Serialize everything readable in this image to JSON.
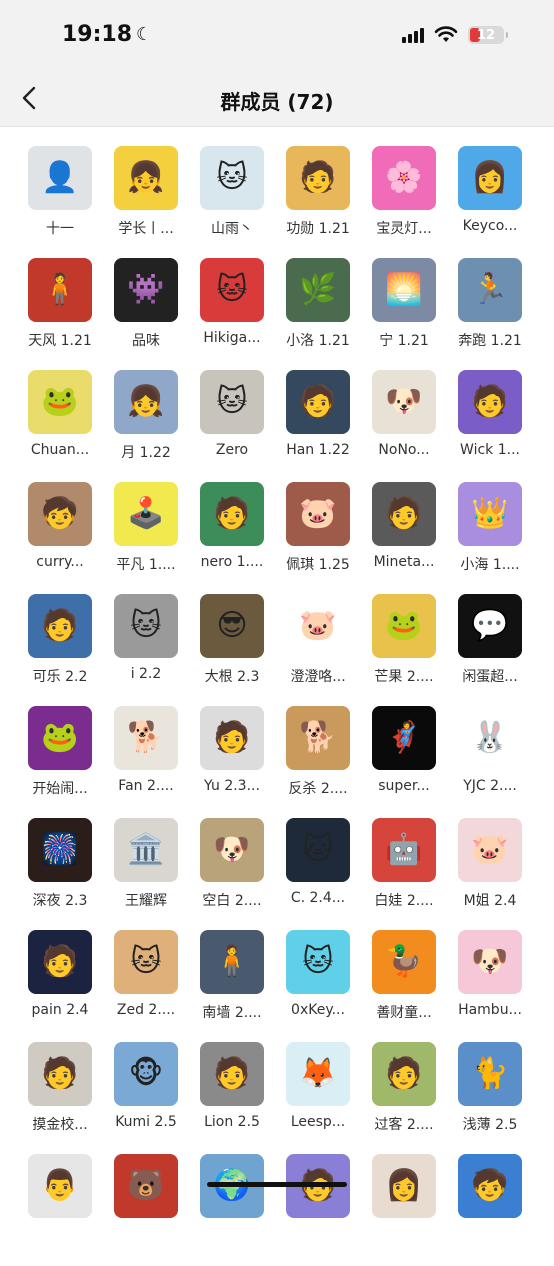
{
  "status_bar": {
    "time": "19:18",
    "battery": "12"
  },
  "header": {
    "title": "群成员 (72)"
  },
  "members": [
    {
      "name": "十一",
      "bg": "#dfe3e6",
      "icon": "👤"
    },
    {
      "name": "学长丨...",
      "bg": "#f4d03f",
      "icon": "👧"
    },
    {
      "name": "山雨丶",
      "bg": "#d8e7ee",
      "icon": "🐱"
    },
    {
      "name": "功勋 1.21",
      "bg": "#e8b75a",
      "icon": "🧑"
    },
    {
      "name": "宝灵灯...",
      "bg": "#f06bb8",
      "icon": "🌸"
    },
    {
      "name": "Keyco...",
      "bg": "#4fa8e8",
      "icon": "👩"
    },
    {
      "name": "天风 1.21",
      "bg": "#c0392b",
      "icon": "🧍"
    },
    {
      "name": "品味",
      "bg": "#222222",
      "icon": "👾"
    },
    {
      "name": "Hikiga...",
      "bg": "#d93b3b",
      "icon": "🐱"
    },
    {
      "name": "小洛 1.21",
      "bg": "#4a6b4e",
      "icon": "🌿"
    },
    {
      "name": "宁 1.21",
      "bg": "#7d8aa3",
      "icon": "🌅"
    },
    {
      "name": "奔跑 1.21",
      "bg": "#6d8fb0",
      "icon": "🏃"
    },
    {
      "name": "Chuan...",
      "bg": "#e9dc6a",
      "icon": "🐸"
    },
    {
      "name": "月 1.22",
      "bg": "#8fa7c9",
      "icon": "👧"
    },
    {
      "name": "Zero",
      "bg": "#c9c4bb",
      "icon": "🐱"
    },
    {
      "name": "Han 1.22",
      "bg": "#34495e",
      "icon": "🧑"
    },
    {
      "name": "NoNo...",
      "bg": "#e8e2d6",
      "icon": "🐶"
    },
    {
      "name": "Wick 1...",
      "bg": "#7b5dc8",
      "icon": "🧑"
    },
    {
      "name": "curry...",
      "bg": "#b08a6a",
      "icon": "🧒"
    },
    {
      "name": "平凡 1....",
      "bg": "#f2e94e",
      "icon": "🕹️"
    },
    {
      "name": "nero 1....",
      "bg": "#3c8d5a",
      "icon": "🧑"
    },
    {
      "name": "佩琪 1.25",
      "bg": "#9e5b4a",
      "icon": "🐷"
    },
    {
      "name": "Mineta...",
      "bg": "#5a5a5a",
      "icon": "🧑"
    },
    {
      "name": "小海 1....",
      "bg": "#a98ee0",
      "icon": "👑"
    },
    {
      "name": "可乐 2.2",
      "bg": "#3f6fa8",
      "icon": "🧑"
    },
    {
      "name": "i 2.2",
      "bg": "#9a9a9a",
      "icon": "🐱"
    },
    {
      "name": "大根 2.3",
      "bg": "#6b5a3e",
      "icon": "😎"
    },
    {
      "name": "澄澄咯...",
      "bg": "#ffffff",
      "icon": "🐷"
    },
    {
      "name": "芒果 2....",
      "bg": "#e8c24a",
      "icon": "🐸"
    },
    {
      "name": "闲蛋超...",
      "bg": "#111111",
      "icon": "💬"
    },
    {
      "name": "开始闹...",
      "bg": "#7b2d8f",
      "icon": "🐸"
    },
    {
      "name": "Fan 2....",
      "bg": "#e9e4dc",
      "icon": "🐕"
    },
    {
      "name": "Yu 2.3...",
      "bg": "#dcdcdc",
      "icon": "🧑"
    },
    {
      "name": "反杀 2....",
      "bg": "#c99a5b",
      "icon": "🐕"
    },
    {
      "name": "super...",
      "bg": "#0a0a0a",
      "icon": "🦸"
    },
    {
      "name": "YJC 2....",
      "bg": "#ffffff",
      "icon": "🐰"
    },
    {
      "name": "深夜 2.3",
      "bg": "#2b1d1a",
      "icon": "🎆"
    },
    {
      "name": "王耀辉",
      "bg": "#d9d6cf",
      "icon": "🏛️"
    },
    {
      "name": "空白 2....",
      "bg": "#b9a37a",
      "icon": "🐶"
    },
    {
      "name": "C. 2.4...",
      "bg": "#1e2a3a",
      "icon": "🐱"
    },
    {
      "name": "白娃 2....",
      "bg": "#d6453c",
      "icon": "🤖"
    },
    {
      "name": "M姐 2.4",
      "bg": "#f2d8da",
      "icon": "🐷"
    },
    {
      "name": "pain 2.4",
      "bg": "#1b2340",
      "icon": "🧑"
    },
    {
      "name": "Zed 2....",
      "bg": "#e0b07a",
      "icon": "🐱"
    },
    {
      "name": "南墙 2....",
      "bg": "#4a5a6e",
      "icon": "🧍"
    },
    {
      "name": "0xKey...",
      "bg": "#5fd0e8",
      "icon": "🐱"
    },
    {
      "name": "善财童...",
      "bg": "#f28c1e",
      "icon": "🦆"
    },
    {
      "name": "Hambu...",
      "bg": "#f6c7d6",
      "icon": "🐶"
    },
    {
      "name": "摸金校...",
      "bg": "#cfcac2",
      "icon": "🧑"
    },
    {
      "name": "Kumi 2.5",
      "bg": "#7aa9d6",
      "icon": "🐵"
    },
    {
      "name": "Lion 2.5",
      "bg": "#8a8a8a",
      "icon": "🧑"
    },
    {
      "name": "Leesp...",
      "bg": "#d9eef5",
      "icon": "🦊"
    },
    {
      "name": "过客 2....",
      "bg": "#9fb86a",
      "icon": "🧑"
    },
    {
      "name": "浅薄 2.5",
      "bg": "#5b8fc9",
      "icon": "🐈"
    },
    {
      "name": "",
      "bg": "#e6e6e6",
      "icon": "👨"
    },
    {
      "name": "",
      "bg": "#c0392b",
      "icon": "🐻"
    },
    {
      "name": "",
      "bg": "#6fa3d0",
      "icon": "🌍"
    },
    {
      "name": "",
      "bg": "#8a7fd6",
      "icon": "🧑"
    },
    {
      "name": "",
      "bg": "#e8dcd0",
      "icon": "👩"
    },
    {
      "name": "",
      "bg": "#3a7fd1",
      "icon": "🧒"
    }
  ]
}
